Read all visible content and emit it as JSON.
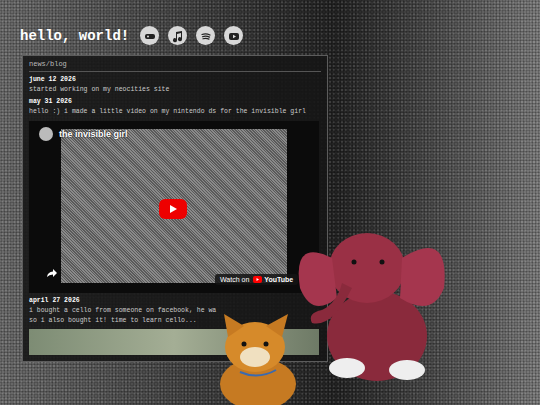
{
  "header": {
    "title": "hello, world!"
  },
  "panel": {
    "title": "news/blog",
    "posts": [
      {
        "kind": "text",
        "date": "june 12 2026",
        "lines": [
          "started working on my neocities site"
        ]
      },
      {
        "kind": "video",
        "date": "may 31 2026",
        "lines": [
          "hello :) i made a little video on my nintendo ds for the invisible girl"
        ],
        "video": {
          "title": "the invisible girl",
          "watch": "Watch on",
          "brand": "YouTube"
        }
      },
      {
        "kind": "image",
        "date": "april 27 2026",
        "lines": [
          "i bought a cello from someone on facebook, he wa",
          "so i also bought it! time to learn cello..."
        ]
      }
    ]
  }
}
